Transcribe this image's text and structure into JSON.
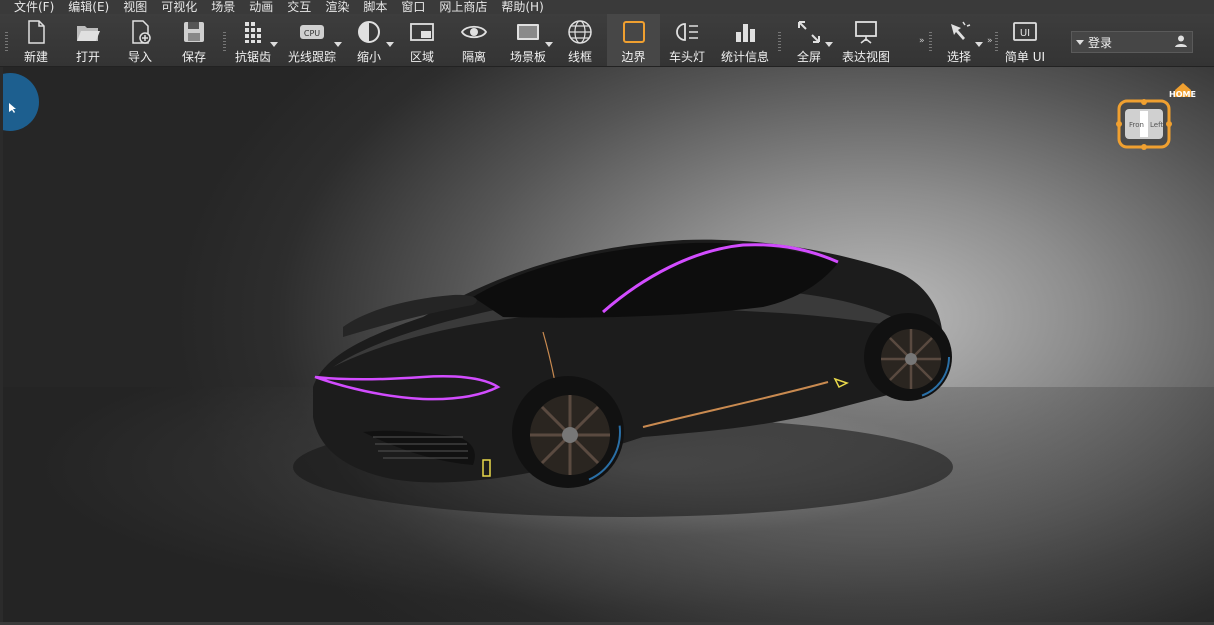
{
  "menu": [
    "文件(F)",
    "编辑(E)",
    "视图",
    "可视化",
    "场景",
    "动画",
    "交互",
    "渲染",
    "脚本",
    "窗口",
    "网上商店",
    "帮助(H)"
  ],
  "toolbar": {
    "new": "新建",
    "open": "打开",
    "import": "导入",
    "save": "保存",
    "antialias": "抗锯齿",
    "raytrace": "光线跟踪",
    "shrink": "缩小",
    "region": "区域",
    "isolate": "隔离",
    "scene_board": "场景板",
    "wireframe": "线框",
    "border": "边界",
    "headlight": "车头灯",
    "stats": "统计信息",
    "fullscreen": "全屏",
    "radar": "表达视图",
    "select": "选择",
    "simple_ui": "简单 UI",
    "ui_badge": "UI",
    "cpu_badge": "CPU"
  },
  "login": {
    "label": "登录"
  },
  "viewcube": {
    "home": "HOME",
    "front": "Fron",
    "left": "Left"
  },
  "colors": {
    "accent_orange": "#f0a030",
    "nav_blue": "#1d5f8f",
    "magenta_trim": "#d24cff"
  }
}
